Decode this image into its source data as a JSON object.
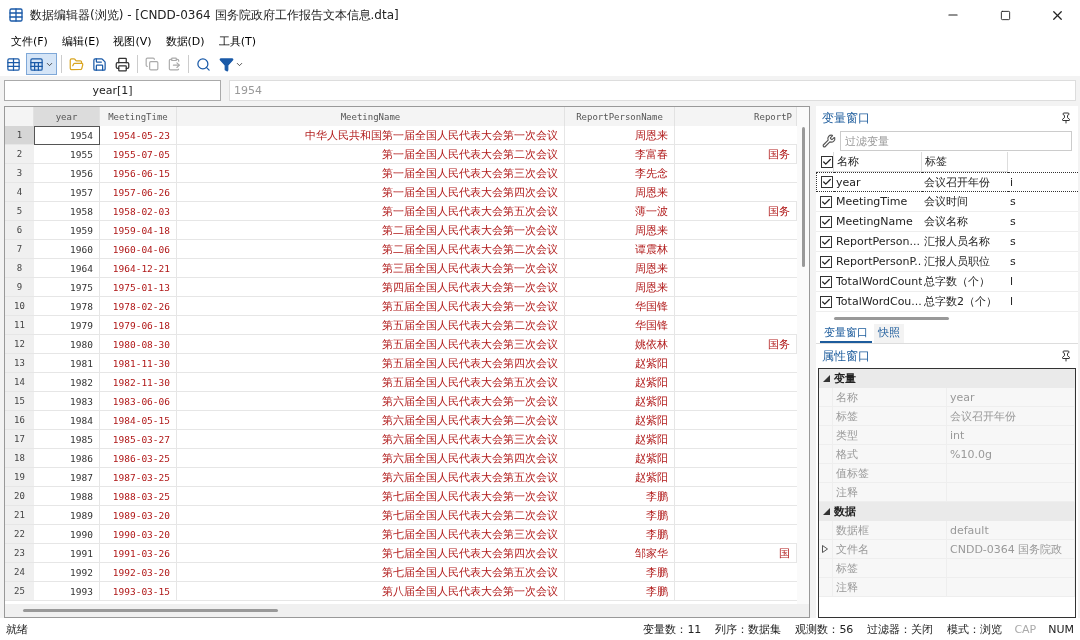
{
  "window": {
    "title": "数据编辑器(浏览) - [CNDD-0364 国务院政府工作报告文本信息.dta]"
  },
  "menu": [
    "文件(F)",
    "编辑(E)",
    "视图(V)",
    "数据(D)",
    "工具(T)"
  ],
  "toolbar": {
    "browse_mode_pressed": true
  },
  "cell_bar": {
    "reference": "year[1]",
    "value": "1954"
  },
  "table": {
    "columns": [
      {
        "name": "year",
        "selected": true
      },
      {
        "name": "MeetingTime",
        "selected": false
      },
      {
        "name": "MeetingName",
        "selected": false
      },
      {
        "name": "ReportPersonName",
        "selected": false
      },
      {
        "name": "ReportP",
        "selected": false
      }
    ],
    "rows": [
      {
        "index": "1",
        "selected": true,
        "year": "1954",
        "time": "1954-05-23",
        "name": "中华人民共和国第一届全国人民代表大会第一次会议",
        "person": "周恩来"
      },
      {
        "index": "2",
        "selected": false,
        "year": "1955",
        "time": "1955-07-05",
        "name": "第一届全国人民代表大会第二次会议",
        "person": "李富春",
        "position": "国务"
      },
      {
        "index": "3",
        "selected": false,
        "year": "1956",
        "time": "1956-06-15",
        "name": "第一届全国人民代表大会第三次会议",
        "person": "李先念"
      },
      {
        "index": "4",
        "selected": false,
        "year": "1957",
        "time": "1957-06-26",
        "name": "第一届全国人民代表大会第四次会议",
        "person": "周恩来"
      },
      {
        "index": "5",
        "selected": false,
        "year": "1958",
        "time": "1958-02-03",
        "name": "第一届全国人民代表大会第五次会议",
        "person": "薄一波",
        "position": "国务"
      },
      {
        "index": "6",
        "selected": false,
        "year": "1959",
        "time": "1959-04-18",
        "name": "第二届全国人民代表大会第一次会议",
        "person": "周恩来"
      },
      {
        "index": "7",
        "selected": false,
        "year": "1960",
        "time": "1960-04-06",
        "name": "第二届全国人民代表大会第二次会议",
        "person": "谭震林"
      },
      {
        "index": "8",
        "selected": false,
        "year": "1964",
        "time": "1964-12-21",
        "name": "第三届全国人民代表大会第一次会议",
        "person": "周恩来"
      },
      {
        "index": "9",
        "selected": false,
        "year": "1975",
        "time": "1975-01-13",
        "name": "第四届全国人民代表大会第一次会议",
        "person": "周恩来"
      },
      {
        "index": "10",
        "selected": false,
        "year": "1978",
        "time": "1978-02-26",
        "name": "第五届全国人民代表大会第一次会议",
        "person": "华国锋"
      },
      {
        "index": "11",
        "selected": false,
        "year": "1979",
        "time": "1979-06-18",
        "name": "第五届全国人民代表大会第二次会议",
        "person": "华国锋"
      },
      {
        "index": "12",
        "selected": false,
        "year": "1980",
        "time": "1980-08-30",
        "name": "第五届全国人民代表大会第三次会议",
        "person": "姚依林",
        "position": "国务"
      },
      {
        "index": "13",
        "selected": false,
        "year": "1981",
        "time": "1981-11-30",
        "name": "第五届全国人民代表大会第四次会议",
        "person": "赵紫阳"
      },
      {
        "index": "14",
        "selected": false,
        "year": "1982",
        "time": "1982-11-30",
        "name": "第五届全国人民代表大会第五次会议",
        "person": "赵紫阳"
      },
      {
        "index": "15",
        "selected": false,
        "year": "1983",
        "time": "1983-06-06",
        "name": "第六届全国人民代表大会第一次会议",
        "person": "赵紫阳"
      },
      {
        "index": "16",
        "selected": false,
        "year": "1984",
        "time": "1984-05-15",
        "name": "第六届全国人民代表大会第二次会议",
        "person": "赵紫阳"
      },
      {
        "index": "17",
        "selected": false,
        "year": "1985",
        "time": "1985-03-27",
        "name": "第六届全国人民代表大会第三次会议",
        "person": "赵紫阳"
      },
      {
        "index": "18",
        "selected": false,
        "year": "1986",
        "time": "1986-03-25",
        "name": "第六届全国人民代表大会第四次会议",
        "person": "赵紫阳"
      },
      {
        "index": "19",
        "selected": false,
        "year": "1987",
        "time": "1987-03-25",
        "name": "第六届全国人民代表大会第五次会议",
        "person": "赵紫阳"
      },
      {
        "index": "20",
        "selected": false,
        "year": "1988",
        "time": "1988-03-25",
        "name": "第七届全国人民代表大会第一次会议",
        "person": "李鹏"
      },
      {
        "index": "21",
        "selected": false,
        "year": "1989",
        "time": "1989-03-20",
        "name": "第七届全国人民代表大会第二次会议",
        "person": "李鹏"
      },
      {
        "index": "22",
        "selected": false,
        "year": "1990",
        "time": "1990-03-20",
        "name": "第七届全国人民代表大会第三次会议",
        "person": "李鹏"
      },
      {
        "index": "23",
        "selected": false,
        "year": "1991",
        "time": "1991-03-26",
        "name": "第七届全国人民代表大会第四次会议",
        "person": "邹家华",
        "position": "国"
      },
      {
        "index": "24",
        "selected": false,
        "year": "1992",
        "time": "1992-03-20",
        "name": "第七届全国人民代表大会第五次会议",
        "person": "李鹏"
      },
      {
        "index": "25",
        "selected": false,
        "year": "1993",
        "time": "1993-03-15",
        "name": "第八届全国人民代表大会第一次会议",
        "person": "李鹏"
      }
    ]
  },
  "variables_panel": {
    "title": "变量窗口",
    "filter_placeholder": "过滤变量",
    "all_checked": true,
    "columns": [
      "名称",
      "标签"
    ],
    "rows": [
      {
        "name": "year",
        "label": "会议召开年份",
        "type": "i",
        "checked": true,
        "selected": true
      },
      {
        "name": "MeetingTime",
        "label": "会议时间",
        "type": "s",
        "checked": true,
        "selected": false
      },
      {
        "name": "MeetingName",
        "label": "会议名称",
        "type": "s",
        "checked": true,
        "selected": false
      },
      {
        "name": "ReportPerson...",
        "label": "汇报人员名称",
        "type": "s",
        "checked": true,
        "selected": false
      },
      {
        "name": "ReportPersonP...",
        "label": "汇报人员职位",
        "type": "s",
        "checked": true,
        "selected": false
      },
      {
        "name": "TotalWordCount",
        "label": "总字数（个）",
        "type": "l",
        "checked": true,
        "selected": false
      },
      {
        "name": "TotalWordCou...",
        "label": "总字数2（个）",
        "type": "l",
        "checked": true,
        "selected": false
      }
    ]
  },
  "panel_tabs": [
    {
      "label": "变量窗口",
      "selected": true
    },
    {
      "label": "快照",
      "selected": false
    }
  ],
  "properties_panel": {
    "title": "属性窗口",
    "groups": [
      {
        "title": "变量",
        "expanded": true,
        "rows": [
          {
            "name": "名称",
            "value": "year"
          },
          {
            "name": "标签",
            "value": "会议召开年份"
          },
          {
            "name": "类型",
            "value": "int"
          },
          {
            "name": "格式",
            "value": "%10.0g"
          },
          {
            "name": "值标签"
          },
          {
            "name": "注释"
          }
        ]
      },
      {
        "title": "数据",
        "expanded": true,
        "rows": [
          {
            "name": "数据框",
            "value": "default"
          },
          {
            "name": "文件名",
            "value": "CNDD-0364 国务院政",
            "expandable": true
          },
          {
            "name": "标签"
          },
          {
            "name": "注释"
          }
        ]
      }
    ]
  },
  "status_bar": {
    "message": "就绪",
    "items": [
      "变量数：11",
      "列序：数据集",
      "观测数：56",
      "过滤器：关闭",
      "模式：浏览"
    ],
    "indicators": [
      {
        "label": "CAP",
        "on": false
      },
      {
        "label": "NUM",
        "on": true
      }
    ]
  }
}
